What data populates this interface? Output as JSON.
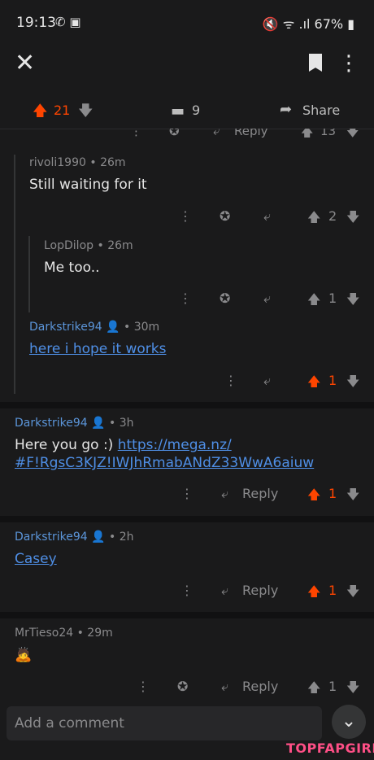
{
  "status_bar": {
    "time": "19:13",
    "left_icons": "✆ ▣",
    "right": "🔇 ᯤ .ıl 67% ▮"
  },
  "app_bar": {
    "close_icon": "✕",
    "more_icon": "⋮"
  },
  "post_actions": {
    "score": "21",
    "comment_count": "9",
    "share_label": "Share"
  },
  "ghost_row": {
    "reply_label": "Reply",
    "score": "13"
  },
  "comments": [
    {
      "user": "rivoli1990",
      "time": "• 26m",
      "text": "Still waiting for it",
      "score": "2"
    },
    {
      "user": "LopDilop",
      "time": "• 26m",
      "text": "Me too..",
      "score": "1"
    },
    {
      "user": "Darkstrike94",
      "time": "• 30m",
      "text": "here i hope it works",
      "score": "1"
    },
    {
      "user": "Darkstrike94",
      "time": "• 3h",
      "text_prefix": "Here you go :) ",
      "link": "https://mega.nz/ #F!RgsC3KJZ!IWJhRmabANdZ33WwA6aiuw",
      "reply_label": "Reply",
      "score": "1"
    },
    {
      "user": "Darkstrike94",
      "time": "• 2h",
      "link": "Casey",
      "reply_label": "Reply",
      "score": "1"
    },
    {
      "user": "MrTieso24",
      "time": "• 29m",
      "emoji": "🙇",
      "reply_label": "Reply",
      "score": "1"
    }
  ],
  "composer": {
    "placeholder": "Add a comment"
  },
  "watermark": "TOPFAPGIRLS",
  "colors": {
    "background": "#1a1a1b",
    "upvote": "#ff4500",
    "link": "#4f8fe6"
  }
}
